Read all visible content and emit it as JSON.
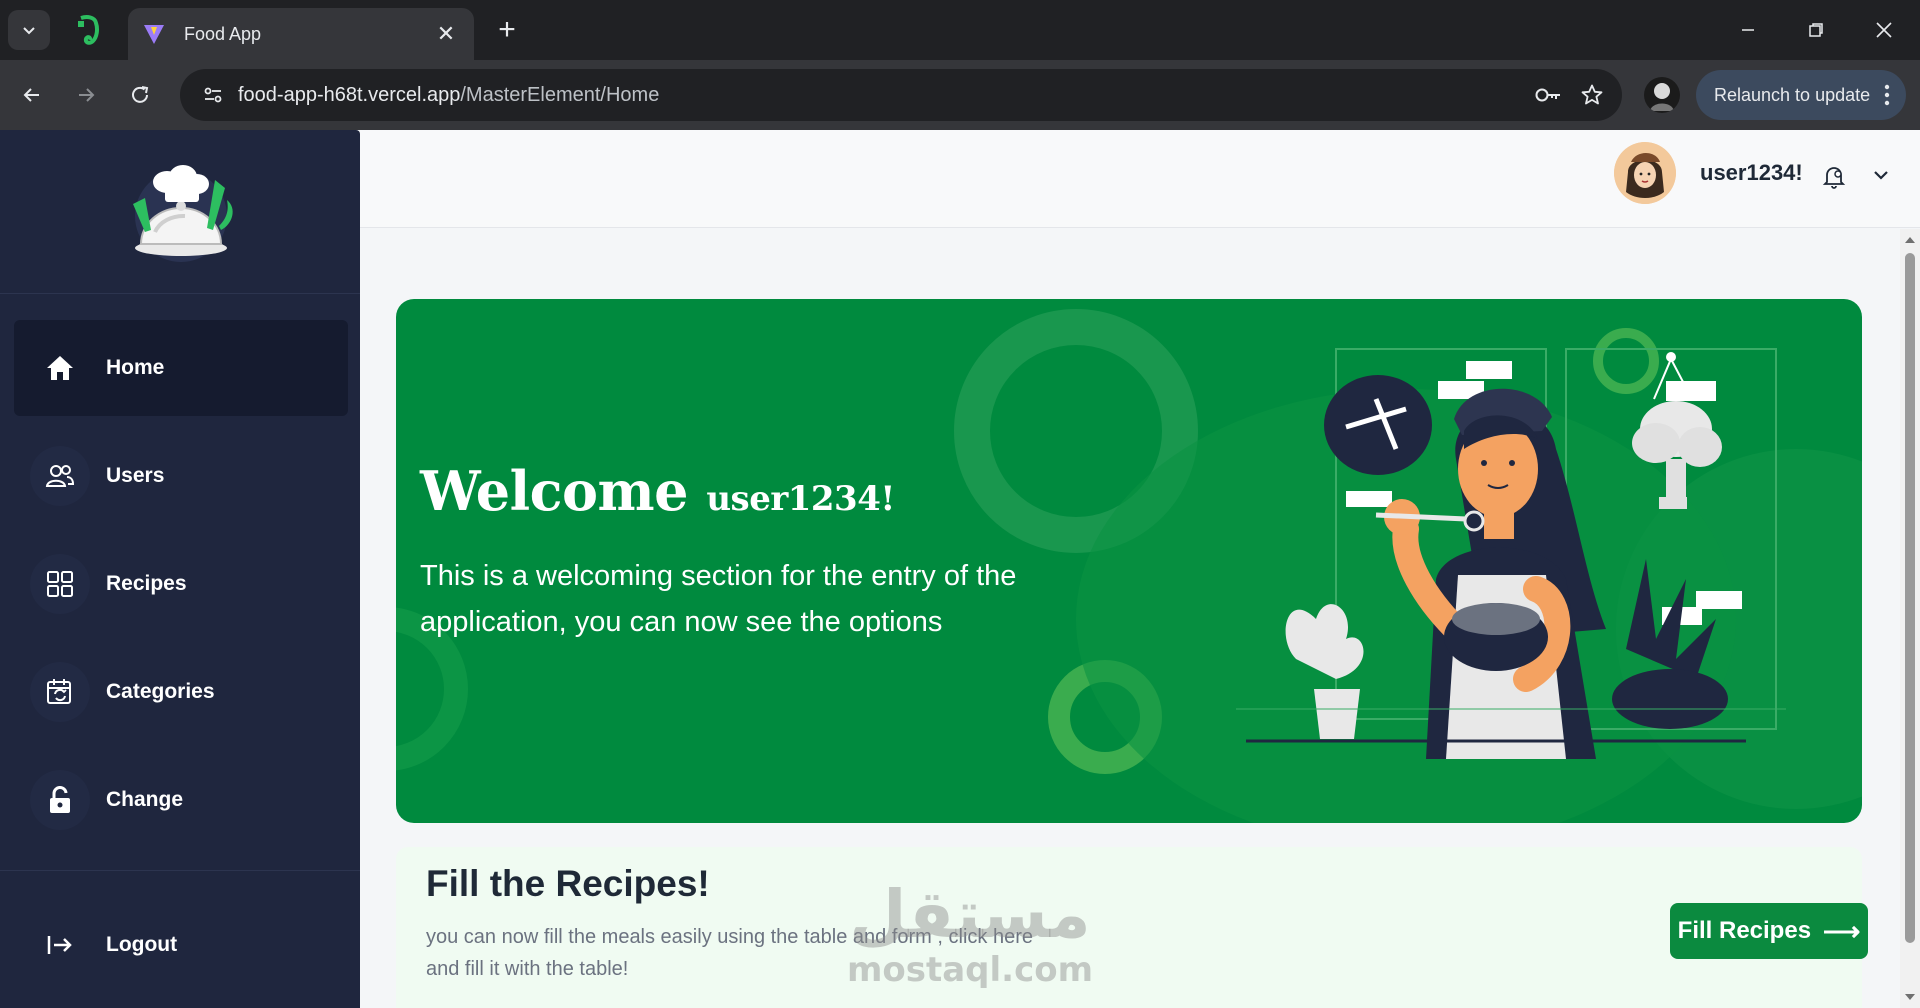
{
  "browser": {
    "tab_title": "Food App",
    "url_host": "food-app-h68t.vercel.app",
    "url_path": "/MasterElement/Home",
    "relaunch_label": "Relaunch to update"
  },
  "sidebar": {
    "items": [
      {
        "label": "Home",
        "icon": "home-icon",
        "active": true
      },
      {
        "label": "Users",
        "icon": "users-icon"
      },
      {
        "label": "Recipes",
        "icon": "grid-icon"
      },
      {
        "label": "Categories",
        "icon": "calendar-icon"
      },
      {
        "label": "Change",
        "icon": "unlock-icon"
      }
    ],
    "logout_label": "Logout"
  },
  "header": {
    "username": "user1234!"
  },
  "hero": {
    "welcome": "Welcome",
    "user": "user1234!",
    "description": "This is a welcoming section for the entry of the application, you can now see the options"
  },
  "fill_card": {
    "title": "Fill the Recipes!",
    "description": "you can now fill the meals easily using the table and form , click here and fill it with the table!",
    "button_label": "Fill Recipes",
    "button_arrow": "⟶"
  },
  "watermark": {
    "arabic": "مستقل",
    "latin": "mostaql.com"
  },
  "colors": {
    "sidebar_bg": "#1f263e",
    "accent_green": "#008a3e",
    "button_green": "#0b8a3f",
    "card_bg": "#f0fbf2"
  }
}
